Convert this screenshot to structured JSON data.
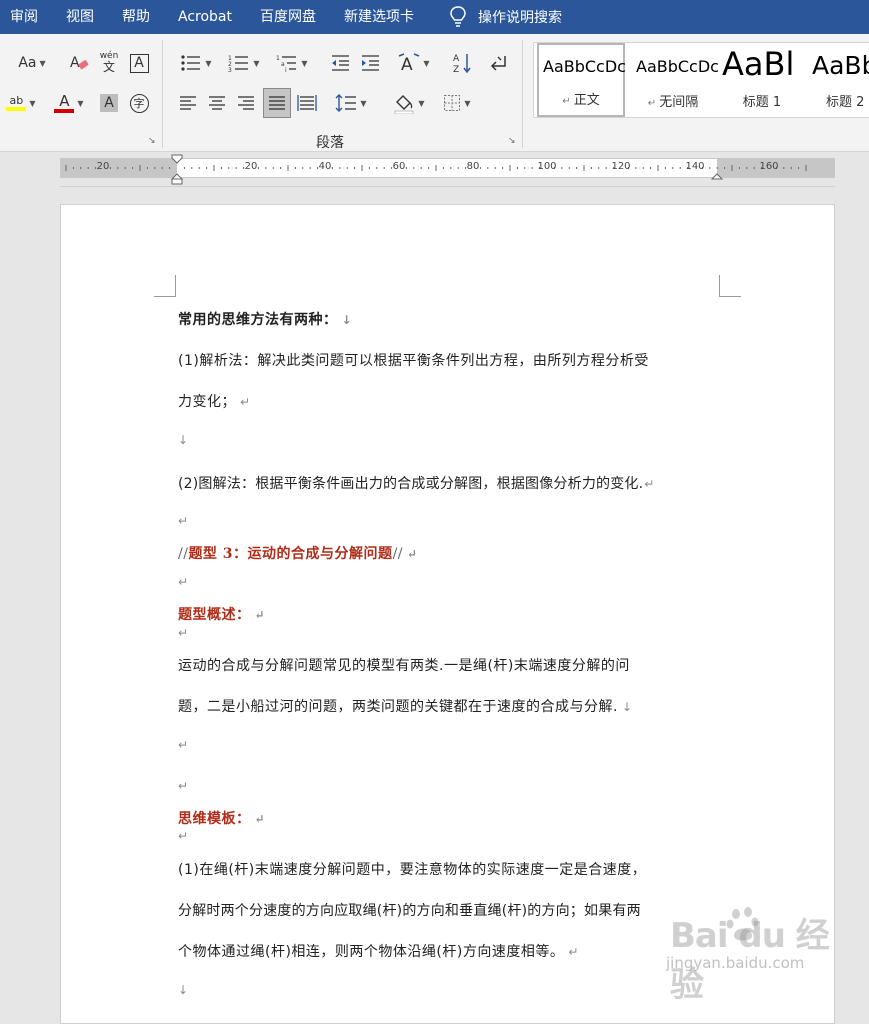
{
  "menu": {
    "items": [
      "审阅",
      "视图",
      "帮助",
      "Acrobat",
      "百度网盘",
      "新建选项卡"
    ],
    "search_label": "操作说明搜索"
  },
  "ribbon": {
    "font_group": {
      "change_case_label": "Aa",
      "phonetic_top": "wén",
      "phonetic_bottom": "文",
      "border_char_label": "A",
      "font_color_label": "A",
      "shading_label": "A",
      "enclose_label": "字",
      "highlight_label": "ab",
      "highlight_color": "#ffff00",
      "font_color": "#d00000"
    },
    "paragraph_group": {
      "label": "段落"
    },
    "styles": [
      {
        "preview": "AaBbCcDc",
        "name": "正文",
        "selected": true
      },
      {
        "preview": "AaBbCcDc",
        "name": "无间隔",
        "selected": false
      },
      {
        "preview": "AaBl",
        "name": "标题 1",
        "selected": false
      },
      {
        "preview": "AaBb",
        "name": "标题 2",
        "selected": false
      }
    ]
  },
  "ruler": {
    "labels": [
      "20",
      "20",
      "40",
      "60",
      "80",
      "100",
      "120",
      "140",
      "160"
    ]
  },
  "document": {
    "paragraphs": [
      {
        "text": "常用的思维方法有两种：",
        "mark": "↓",
        "style": "bold"
      },
      {
        "text": "(1)解析法：解决此类问题可以根据平衡条件列出方程，由所列方程分析受",
        "mark": "",
        "style": "normal"
      },
      {
        "text": "力变化；",
        "mark": "↵",
        "style": "normal"
      },
      {
        "text": "",
        "mark": "↓",
        "style": "normal"
      },
      {
        "text": "(2)图解法：根据平衡条件画出力的合成或分解图，根据图像分析力的变化.",
        "mark": "↵",
        "style": "normal"
      },
      {
        "text": "",
        "mark": "↵",
        "style": "normal"
      },
      {
        "prefix": "//",
        "text": "题型 3：运动的合成与分解问题",
        "suffix": "//",
        "mark": "↵",
        "style": "red"
      },
      {
        "text": "",
        "mark": "↵",
        "style": "normal"
      },
      {
        "text": "题型概述：",
        "mark": "↵",
        "style": "red"
      },
      {
        "text": "",
        "mark": "↵",
        "style": "normal"
      },
      {
        "text": "运动的合成与分解问题常见的模型有两类.一是绳(杆)末端速度分解的问",
        "mark": "",
        "style": "normal"
      },
      {
        "text": "题，二是小船过河的问题，两类问题的关键都在于速度的合成与分解.",
        "mark": "↓",
        "style": "normal"
      },
      {
        "text": "",
        "mark": "↵",
        "style": "normal"
      },
      {
        "text": "",
        "mark": "↵",
        "style": "normal"
      },
      {
        "text": "思维模板：",
        "mark": "↵",
        "style": "red"
      },
      {
        "text": "",
        "mark": "↵",
        "style": "normal"
      },
      {
        "text": "(1)在绳(杆)末端速度分解问题中，要注意物体的实际速度一定是合速度，",
        "mark": "",
        "style": "normal"
      },
      {
        "text": "分解时两个分速度的方向应取绳(杆)的方向和垂直绳(杆)的方向；如果有两",
        "mark": "",
        "style": "normal"
      },
      {
        "text": "个物体通过绳(杆)相连，则两个物体沿绳(杆)方向速度相等。",
        "mark": "↵",
        "style": "normal"
      },
      {
        "text": "",
        "mark": "↓",
        "style": "normal"
      }
    ]
  },
  "watermark": {
    "main": "Bai du 经验",
    "sub": "jingyan.baidu.com"
  }
}
